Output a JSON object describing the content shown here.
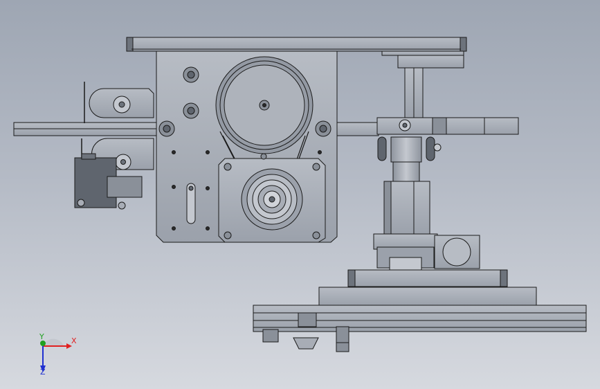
{
  "colors": {
    "background_top": "#9ea6b3",
    "background_bottom": "#d6d9df",
    "part_fill": "#a8adb6",
    "part_edge": "#1a1a1a",
    "x_axis": "#e02020",
    "y_axis": "#20a020",
    "z_axis": "#2030d0"
  },
  "triad": {
    "x_label": "X",
    "y_label": "Y",
    "z_label": "Z"
  }
}
